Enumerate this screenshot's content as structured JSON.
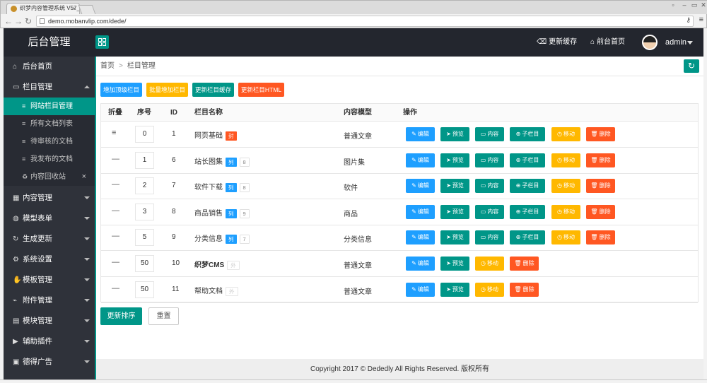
{
  "browser": {
    "tab_title": "织梦内容管理系统 V57_...",
    "tab_close": "×",
    "url": "demo.mobanvlip.com/dede/"
  },
  "header": {
    "brand": "后台管理",
    "update_cache": "更新缓存",
    "frontend_home": "前台首页",
    "username": "admin"
  },
  "sidebar": {
    "items": [
      {
        "label": "后台首页",
        "icon": "home-icon"
      },
      {
        "label": "栏目管理",
        "icon": "monitor-icon"
      },
      {
        "label": "内容管理",
        "icon": "grid-icon"
      },
      {
        "label": "模型表单",
        "icon": "globe-icon"
      },
      {
        "label": "生成更新",
        "icon": "refresh-icon"
      },
      {
        "label": "系统设置",
        "icon": "gear-icon"
      },
      {
        "label": "模板管理",
        "icon": "hand-icon"
      },
      {
        "label": "附件管理",
        "icon": "attachment-icon"
      },
      {
        "label": "模块管理",
        "icon": "module-icon"
      },
      {
        "label": "辅助插件",
        "icon": "plugin-icon"
      },
      {
        "label": "德得广告",
        "icon": "ad-icon"
      }
    ],
    "sub_items": [
      {
        "label": "网站栏目管理"
      },
      {
        "label": "所有文档列表"
      },
      {
        "label": "待审核的文档"
      },
      {
        "label": "我发布的文档"
      },
      {
        "label": "内容回收站",
        "close": "×"
      }
    ]
  },
  "breadcrumb": {
    "home": "首页",
    "separator": ">",
    "current": "栏目管理"
  },
  "toolbar": {
    "add_top": "增加顶级栏目",
    "batch_add": "批量增加栏目",
    "update_cache": "更新栏目缓存",
    "update_html": "更新栏目HTML"
  },
  "table": {
    "headers": [
      "折叠",
      "序号",
      "ID",
      "栏目名称",
      "内容模型",
      "操作"
    ],
    "rows": [
      {
        "fold": "≡",
        "sort": "0",
        "id": "1",
        "name": "网页基础",
        "tag": "封",
        "count": "",
        "model": "普通文章",
        "full": true
      },
      {
        "fold": "—",
        "sort": "1",
        "id": "6",
        "name": "站长图集",
        "tag": "列",
        "count": "8",
        "model": "图片集",
        "full": true
      },
      {
        "fold": "—",
        "sort": "2",
        "id": "7",
        "name": "软件下载",
        "tag": "列",
        "count": "8",
        "model": "软件",
        "full": true
      },
      {
        "fold": "—",
        "sort": "3",
        "id": "8",
        "name": "商品销售",
        "tag": "列",
        "count": "9",
        "model": "商品",
        "full": true
      },
      {
        "fold": "—",
        "sort": "5",
        "id": "9",
        "name": "分类信息",
        "tag": "列",
        "count": "7",
        "model": "分类信息",
        "full": true
      },
      {
        "fold": "—",
        "sort": "50",
        "id": "10",
        "name": "织梦CMS",
        "tag": "外",
        "count": "",
        "model": "普通文章",
        "full": false
      },
      {
        "fold": "—",
        "sort": "50",
        "id": "11",
        "name": "帮助文档",
        "tag": "外",
        "count": "",
        "model": "普通文章",
        "full": false
      }
    ],
    "actions": {
      "edit": "编辑",
      "preview": "预览",
      "content": "内容",
      "subcat": "子栏目",
      "move": "移动",
      "delete": "删除"
    }
  },
  "buttons": {
    "update_sort": "更新排序",
    "reset": "重置"
  },
  "footer": {
    "copyright": "Copyright 2017 © Dededly All Rights Reserved. 版权所有"
  },
  "colors": {
    "teal": "#009688",
    "blue": "#1e9fff",
    "yellow": "#ffb800",
    "red": "#ff5722",
    "header_bg": "#23262e",
    "sidebar_bg": "#2f323a"
  }
}
